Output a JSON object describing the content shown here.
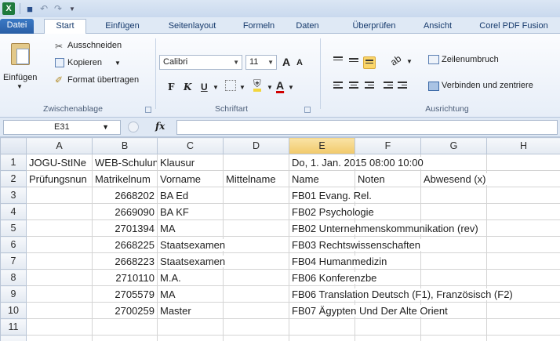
{
  "quickaccess": {
    "app_icon": "X",
    "save": "save-icon",
    "undo": "undo-icon",
    "redo": "redo-icon"
  },
  "tabs": [
    "Datei",
    "Start",
    "Einfügen",
    "Seitenlayout",
    "Formeln",
    "Daten",
    "Überprüfen",
    "Ansicht",
    "Corel PDF Fusion"
  ],
  "ribbon": {
    "clipboard": {
      "paste": "Einfügen",
      "cut": "Ausschneiden",
      "copy": "Kopieren",
      "format_painter": "Format übertragen",
      "label": "Zwischenablage"
    },
    "font": {
      "name": "Calibri",
      "size": "11",
      "grow": "A",
      "shrink": "A",
      "bold": "F",
      "italic": "K",
      "underline": "U",
      "label": "Schriftart"
    },
    "alignment": {
      "wrap": "Zeilenumbruch",
      "merge": "Verbinden und zentriere",
      "label": "Ausrichtung"
    }
  },
  "formula_bar": {
    "name_box": "E31",
    "fx": "fx",
    "value": ""
  },
  "grid": {
    "columns": [
      "A",
      "B",
      "C",
      "D",
      "E",
      "F",
      "G",
      "H"
    ],
    "selected_column": "E",
    "rows": [
      {
        "n": "1",
        "A": "JOGU-StINe",
        "B": "WEB-Schulun",
        "C": "Klausur",
        "D": "",
        "E": "Do, 1. Jan. 2015 08:00 10:00",
        "F": "",
        "G": "",
        "H": ""
      },
      {
        "n": "2",
        "A": "Prüfungsnun",
        "B": "Matrikelnum",
        "C": "Vorname",
        "D": "Mittelname",
        "E": "Name",
        "F": "Noten",
        "G": "Abwesend (x)",
        "H": ""
      },
      {
        "n": "3",
        "A": "",
        "B": "2668202",
        "C": "BA Ed",
        "D": "",
        "E": "FB01 Evang. Rel.",
        "F": "",
        "G": "",
        "H": ""
      },
      {
        "n": "4",
        "A": "",
        "B": "2669090",
        "C": "BA KF",
        "D": "",
        "E": "FB02 Psychologie",
        "F": "",
        "G": "",
        "H": ""
      },
      {
        "n": "5",
        "A": "",
        "B": "2701394",
        "C": "MA",
        "D": "",
        "E": "FB02 Unternehmenskommunikation (rev)",
        "F": "",
        "G": "",
        "H": ""
      },
      {
        "n": "6",
        "A": "",
        "B": "2668225",
        "C": "Staatsexamen",
        "D": "",
        "E": "FB03 Rechtswissenschaften",
        "F": "",
        "G": "",
        "H": ""
      },
      {
        "n": "7",
        "A": "",
        "B": "2668223",
        "C": "Staatsexamen",
        "D": "",
        "E": "FB04 Humanmedizin",
        "F": "",
        "G": "",
        "H": ""
      },
      {
        "n": "8",
        "A": "",
        "B": "2710110",
        "C": "M.A.",
        "D": "",
        "E": "FB06 Konferenzbe",
        "F": "",
        "G": "",
        "H": ""
      },
      {
        "n": "9",
        "A": "",
        "B": "2705579",
        "C": "MA",
        "D": "",
        "E": "FB06 Translation Deutsch (F1), Französisch (F2)",
        "F": "",
        "G": "",
        "H": ""
      },
      {
        "n": "10",
        "A": "",
        "B": "2700259",
        "C": "Master",
        "D": "",
        "E": "FB07 Ägypten Und Der Alte Orient",
        "F": "",
        "G": "",
        "H": ""
      },
      {
        "n": "11",
        "A": "",
        "B": "",
        "C": "",
        "D": "",
        "E": "",
        "F": "",
        "G": "",
        "H": ""
      },
      {
        "n": "",
        "A": "",
        "B": "",
        "C": "",
        "D": "",
        "E": "",
        "F": "",
        "G": "",
        "H": ""
      }
    ]
  }
}
